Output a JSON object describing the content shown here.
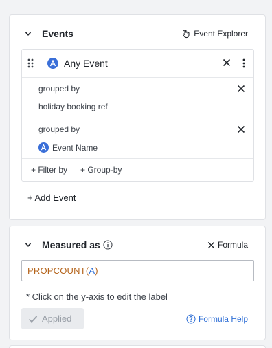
{
  "events_panel": {
    "title": "Events",
    "explorer_label": "Event Explorer",
    "event": {
      "avatar_letter": "A",
      "name": "Any Event",
      "groups": [
        {
          "label": "grouped by",
          "value": "holiday booking ref",
          "has_avatar": false
        },
        {
          "label": "grouped by",
          "value": "Event Name",
          "has_avatar": true
        }
      ],
      "filter_label": "+ Filter by",
      "groupby_label": "+ Group-by"
    },
    "add_event_label": "+ Add Event"
  },
  "measured_panel": {
    "title": "Measured as",
    "formula_toggle_label": "Formula",
    "formula": {
      "fn": "PROPCOUNT",
      "open": "(",
      "arg": "A",
      "close": ")"
    },
    "hint": "* Click on the y-axis to edit the label",
    "applied_label": "Applied",
    "help_label": "Formula Help"
  },
  "icons": {
    "collapse": "chevron-down-icon",
    "explorer": "pointer-hand-icon",
    "drag": "drag-handle-icon",
    "close": "close-icon",
    "more": "vertical-dots-icon",
    "info": "info-circle-icon",
    "check": "check-icon",
    "help": "question-circle-icon"
  },
  "colors": {
    "accent_blue": "#3a6fd8",
    "link_blue": "#2f6fd6",
    "function_orange": "#b5651d",
    "disabled_gray": "#9aa0a8"
  }
}
